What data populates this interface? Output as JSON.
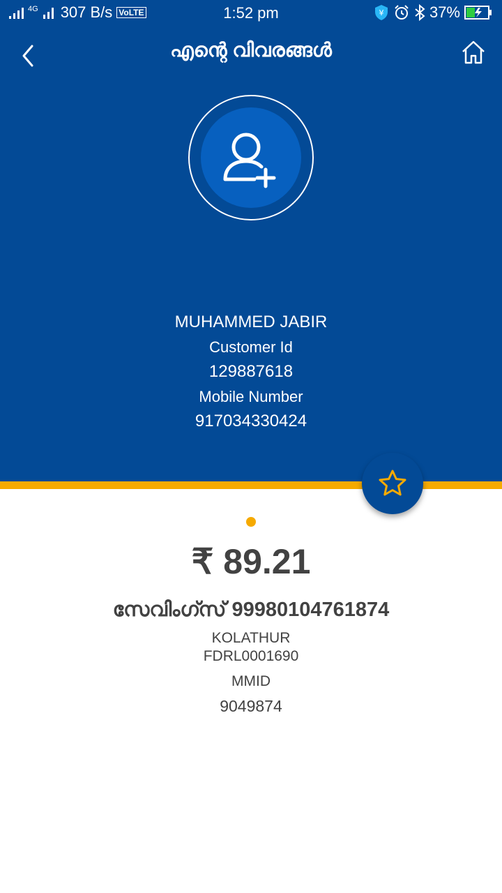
{
  "status_bar": {
    "network": "4G",
    "speed": "307 B/s",
    "volte": "VoLTE",
    "time": "1:52 pm",
    "battery": "37%"
  },
  "header": {
    "title": "എന്റെ വിവരങ്ങൾ",
    "back_icon": "chevron-left-icon",
    "home_icon": "home-icon"
  },
  "profile": {
    "avatar_icon": "add-user-icon",
    "name": "MUHAMMED JABIR",
    "customer_id_label": "Customer Id",
    "customer_id": "129887618",
    "mobile_label": "Mobile Number",
    "mobile": "917034330424"
  },
  "account": {
    "favorite_icon": "star-icon",
    "balance": "₹ 89.21",
    "account_title": "സേവിംഗ്സ് 99980104761874",
    "branch": "KOLATHUR",
    "ifsc": "FDRL0001690",
    "mmid_label": "MMID",
    "mmid": "9049874"
  },
  "colors": {
    "primary": "#034a96",
    "accent": "#f6aa00",
    "text": "#424242"
  }
}
